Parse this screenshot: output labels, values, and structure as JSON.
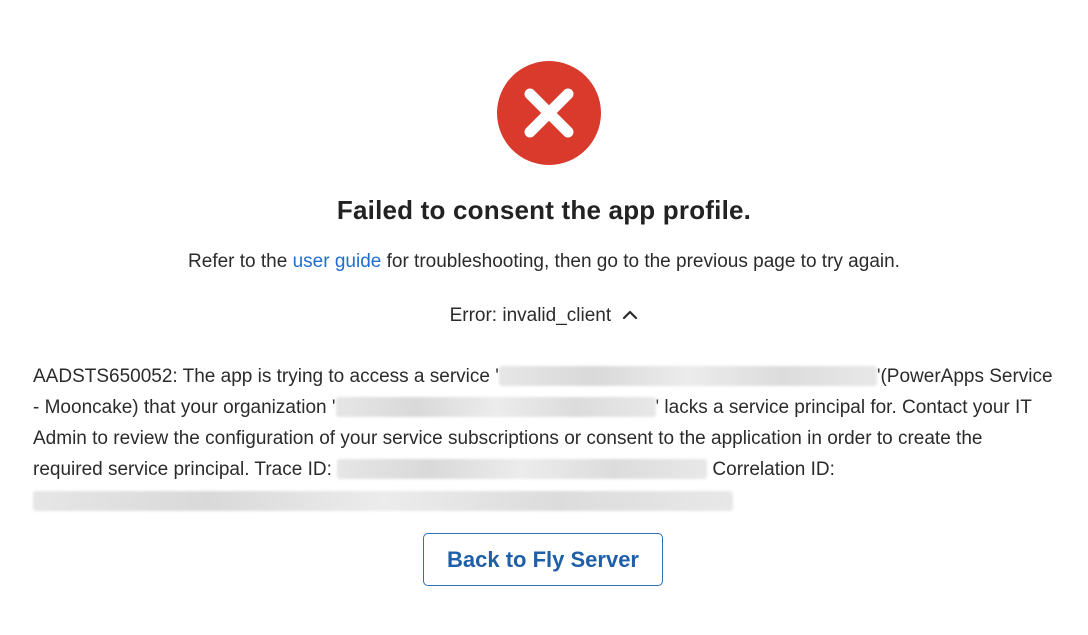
{
  "colors": {
    "error_icon_bg": "#D93A2B",
    "link": "#1F6FD0",
    "button_border": "#2F6FB7",
    "button_text": "#1F5FA8"
  },
  "icon": {
    "status": "x-circle-icon",
    "toggle": "chevron-up-icon"
  },
  "header": {
    "title": "Failed to consent the app profile."
  },
  "subtitle": {
    "before": "Refer to the ",
    "link_text": "user guide",
    "after": " for troubleshooting, then go to the previous page to try again."
  },
  "error": {
    "toggle_label": "Error: invalid_client",
    "message_part1": "AADSTS650052: The app is trying to access a service '",
    "message_part2": "'(PowerApps Service - Mooncake) that your organization '",
    "message_part3": "' lacks a service principal for. Contact your IT Admin to review the configuration of your service subscriptions or consent to the application in order to create the required service principal. Trace ID: ",
    "message_part4": " Correlation ID: "
  },
  "actions": {
    "back_button": "Back to Fly Server"
  }
}
